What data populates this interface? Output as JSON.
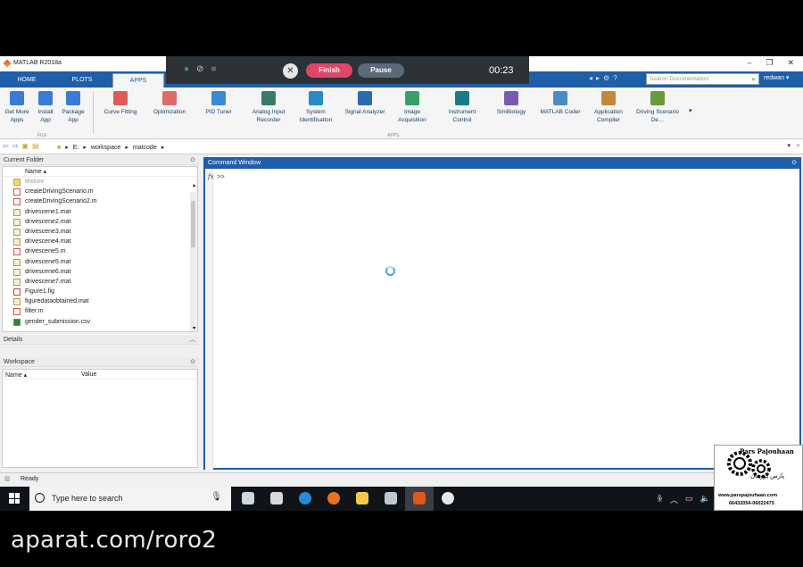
{
  "window": {
    "title": "MATLAB R2018a",
    "controls": [
      "–",
      "❐",
      "✕"
    ]
  },
  "tabs": {
    "home": "HOME",
    "plots": "PLOTS",
    "apps": "APPS"
  },
  "search": {
    "placeholder": "Search Documentation"
  },
  "user": {
    "name": "redwan ▾"
  },
  "ribbon": {
    "file_buttons": [
      {
        "label": "Get More Apps",
        "icon": "get-more-apps-icon"
      },
      {
        "label": "Install App",
        "icon": "install-app-icon"
      },
      {
        "label": "Package App",
        "icon": "package-app-icon"
      }
    ],
    "file_group": "FILE",
    "apps_group": "APPS",
    "apps": [
      {
        "label": "Curve Fitting",
        "color": "#e05a5a"
      },
      {
        "label": "Optimization",
        "color": "#e06a6a"
      },
      {
        "label": "PID Tuner",
        "color": "#3a8ad6"
      },
      {
        "label": "Analog Input Recorder",
        "color": "#3a7a6a"
      },
      {
        "label": "System Identification",
        "color": "#2a8ac6"
      },
      {
        "label": "Signal Analyzer",
        "color": "#2a6ab0"
      },
      {
        "label": "Image Acquisition",
        "color": "#3aa06a"
      },
      {
        "label": "Instrument Control",
        "color": "#1a7a8a"
      },
      {
        "label": "SimBiology",
        "color": "#7a5ab0"
      },
      {
        "label": "MATLAB Coder",
        "color": "#4a8ac6"
      },
      {
        "label": "Application Compiler",
        "color": "#c08a3a"
      },
      {
        "label": "Driving Scenario De…",
        "color": "#6a9a3a"
      }
    ]
  },
  "address": {
    "drive": "E:",
    "folder1": "workspace",
    "folder2": "matcode"
  },
  "current_folder": {
    "title": "Current Folder",
    "name_col": "Name ▴",
    "files": [
      {
        "name": "texture",
        "type": "folder"
      },
      {
        "name": "createDrivingScenario.m",
        "type": "m"
      },
      {
        "name": "createDrivingScenario2.m",
        "type": "m"
      },
      {
        "name": "drivescene1.mat",
        "type": "mat"
      },
      {
        "name": "drivescene2.mat",
        "type": "mat"
      },
      {
        "name": "drivescene3.mat",
        "type": "mat"
      },
      {
        "name": "drivescene4.mat",
        "type": "mat"
      },
      {
        "name": "drivescene5.m",
        "type": "m"
      },
      {
        "name": "drivescene5.mat",
        "type": "mat"
      },
      {
        "name": "drivescene6.mat",
        "type": "mat"
      },
      {
        "name": "drivescene7.mat",
        "type": "mat"
      },
      {
        "name": "Figure1.fig",
        "type": "fig"
      },
      {
        "name": "figuredataobtained.mat",
        "type": "mat"
      },
      {
        "name": "filter.m",
        "type": "m"
      },
      {
        "name": "gender_submission.csv",
        "type": "csv"
      }
    ]
  },
  "details": {
    "title": "Details"
  },
  "workspace": {
    "title": "Workspace",
    "col_name": "Name ▴",
    "col_value": "Value"
  },
  "command_window": {
    "title": "Command Window",
    "fx": "fx",
    "prompt": ">>"
  },
  "status": {
    "text": "Ready"
  },
  "recorder": {
    "finish": "Finish",
    "pause": "Pause",
    "time": "00:23",
    "finish_color": "#e0466a",
    "pause_color": "#5a6a7a"
  },
  "taskbar": {
    "search_placeholder": "Type here to search",
    "apps": [
      {
        "icon": "task-view-icon",
        "color": "#cfd8e0"
      },
      {
        "icon": "cloud-app-icon",
        "color": "#d8d8d8"
      },
      {
        "icon": "edge-icon",
        "color": "#2a8ad8"
      },
      {
        "icon": "firefox-icon",
        "color": "#e8721c"
      },
      {
        "icon": "file-explorer-icon",
        "color": "#f2c94c"
      },
      {
        "icon": "mail-icon",
        "color": "#bfc8d0"
      },
      {
        "icon": "matlab-icon",
        "color": "#e0561b"
      },
      {
        "icon": "onedrive-icon",
        "color": "#e8e8e8"
      }
    ]
  },
  "brand": {
    "name": "Pars Pajouhaan",
    "name_fa": "پارس پژوهان",
    "site": "www.parspajouhaan.com",
    "tel": "66432054-06022475"
  },
  "watermark": "aparat.com/roro2"
}
